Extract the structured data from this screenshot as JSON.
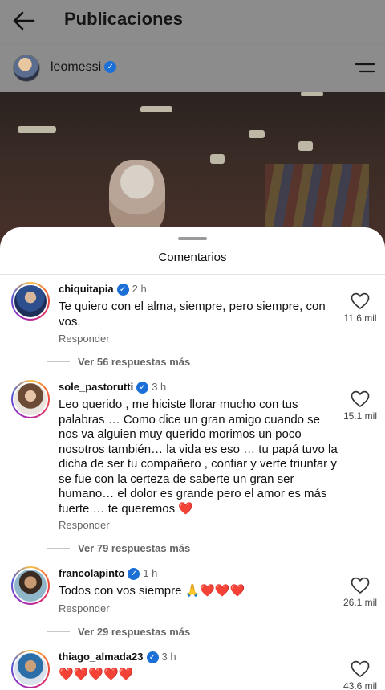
{
  "header": {
    "title": "Publicaciones"
  },
  "profile": {
    "username": "leomessi"
  },
  "sheet": {
    "title": "Comentarios"
  },
  "comments": [
    {
      "username": "chiquitapia",
      "time": "2 h",
      "text": "Te quiero con el alma, siempre, pero siempre, con vos.",
      "reply_label": "Responder",
      "likes": "11.6 mil",
      "more_replies": "Ver 56 respuestas más"
    },
    {
      "username": "sole_pastorutti",
      "time": "3 h",
      "text": "Leo querido , me hiciste llorar mucho con tus palabras … Como dice un gran amigo cuando se nos va alguien muy querido morimos un poco nosotros también… la vida es eso … tu papá tuvo la dicha de ser tu compañero , confiar y verte triunfar y se fue con la certeza de saberte un gran ser humano…  el dolor es grande pero el amor es más fuerte … te queremos ❤️",
      "reply_label": "Responder",
      "likes": "15.1 mil",
      "more_replies": "Ver 79 respuestas más"
    },
    {
      "username": "francolapinto",
      "time": "1 h",
      "text": "Todos con vos siempre 🙏❤️❤️❤️",
      "reply_label": "Responder",
      "likes": "26.1 mil",
      "more_replies": "Ver 29 respuestas más"
    },
    {
      "username": "thiago_almada23",
      "time": "3 h",
      "text": "❤️❤️❤️❤️❤️",
      "likes": "43.6 mil"
    }
  ],
  "colors": {
    "verified": "#1b6fd6",
    "sheet_bg": "#ffffff",
    "dim_bg": "#8c8c8c"
  }
}
